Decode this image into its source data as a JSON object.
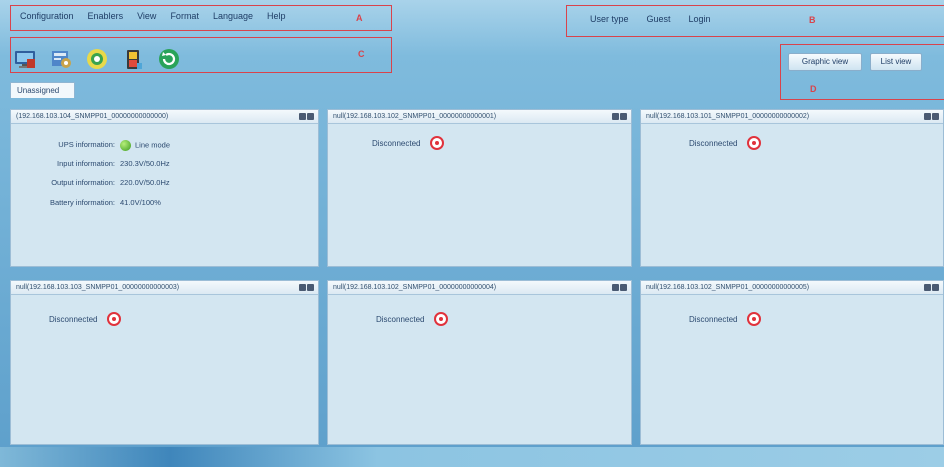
{
  "menu": [
    "Configuration",
    "Enablers",
    "View",
    "Format",
    "Language",
    "Help"
  ],
  "regions": {
    "a": "A",
    "b": "B",
    "c": "C",
    "d": "D"
  },
  "user": {
    "type_label": "User type",
    "type_value": "Guest",
    "login": "Login"
  },
  "toolbar": [
    {
      "name": "monitor-icon",
      "color": "#3a6fb3"
    },
    {
      "name": "settings-icon",
      "color": "#5a8fd0"
    },
    {
      "name": "record-icon",
      "color": "#f0d84a"
    },
    {
      "name": "battery-icon",
      "color": "#e34b3c"
    },
    {
      "name": "refresh-icon",
      "color": "#2ea85a"
    }
  ],
  "views": {
    "graphic": "Graphic view",
    "list": "List view"
  },
  "group_tab": "Unassigned",
  "panels": [
    {
      "title": "(192.168.103.104_SNMPP01_00000000000000)",
      "info": {
        "ups_label": "UPS information:",
        "ups_value": "Line mode",
        "input_label": "Input information:",
        "input_value": "230.3V/50.0Hz",
        "output_label": "Output information:",
        "output_value": "220.0V/50.0Hz",
        "battery_label": "Battery information:",
        "battery_value": "41.0V/100%"
      }
    },
    {
      "title": "null(192.168.103.102_SNMPP01_00000000000001)",
      "status": "Disconnected"
    },
    {
      "title": "null(192.168.103.101_SNMPP01_00000000000002)",
      "status": "Disconnected"
    },
    {
      "title": "null(192.168.103.103_SNMPP01_00000000000003)",
      "status": "Disconnected"
    },
    {
      "title": "null(192.168.103.102_SNMPP01_00000000000004)",
      "status": "Disconnected"
    },
    {
      "title": "null(192.168.103.102_SNMPP01_00000000000005)",
      "status": "Disconnected"
    }
  ]
}
